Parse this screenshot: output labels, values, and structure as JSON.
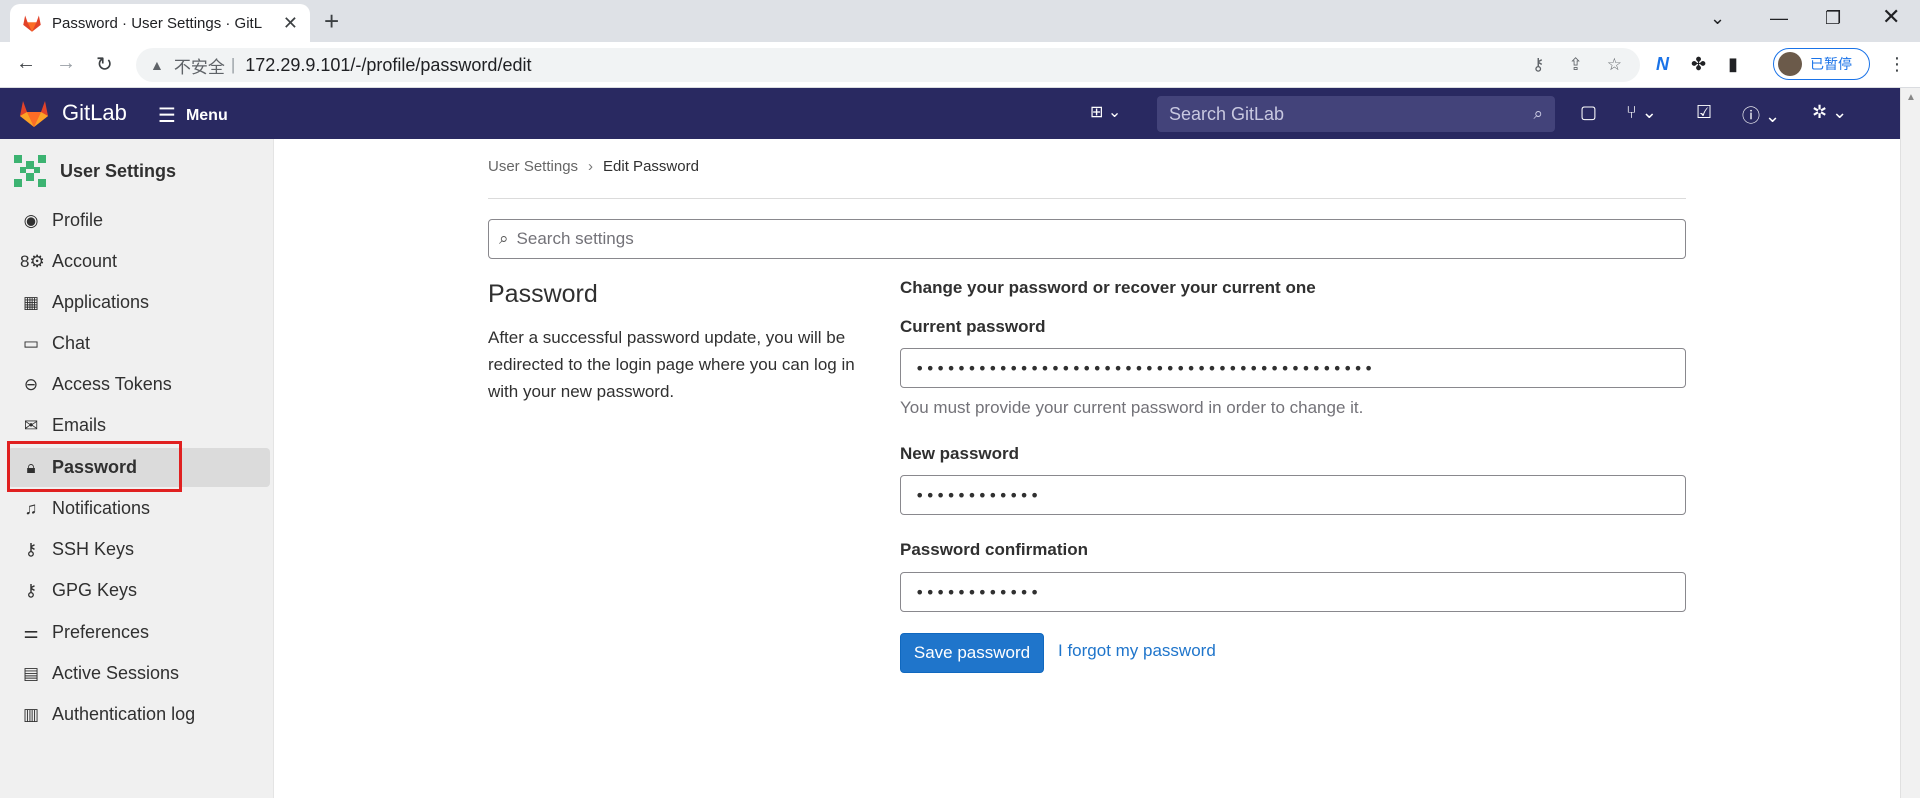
{
  "browser": {
    "tab_title": "Password · User Settings · GitL",
    "insecure_label": "不安全",
    "separator": "|",
    "url": "172.29.9.101/-/profile/password/edit",
    "profile_label": "已暂停"
  },
  "topnav": {
    "brand": "GitLab",
    "menu_label": "Menu",
    "search_placeholder": "Search GitLab"
  },
  "sidebar": {
    "title": "User Settings",
    "items": [
      {
        "label": "Profile",
        "icon": "profile-icon"
      },
      {
        "label": "Account",
        "icon": "account-icon"
      },
      {
        "label": "Applications",
        "icon": "applications-icon"
      },
      {
        "label": "Chat",
        "icon": "chat-icon"
      },
      {
        "label": "Access Tokens",
        "icon": "token-icon"
      },
      {
        "label": "Emails",
        "icon": "mail-icon"
      },
      {
        "label": "Password",
        "icon": "lock-icon",
        "active": true
      },
      {
        "label": "Notifications",
        "icon": "bell-icon"
      },
      {
        "label": "SSH Keys",
        "icon": "key-icon"
      },
      {
        "label": "GPG Keys",
        "icon": "key-icon"
      },
      {
        "label": "Preferences",
        "icon": "preferences-icon"
      },
      {
        "label": "Active Sessions",
        "icon": "monitor-icon"
      },
      {
        "label": "Authentication log",
        "icon": "log-icon"
      }
    ]
  },
  "breadcrumb": {
    "parent": "User Settings",
    "current": "Edit Password"
  },
  "settings_search": {
    "placeholder": "Search settings"
  },
  "section": {
    "title": "Password",
    "description": "After a successful password update, you will be redirected to the login page where you can log in with your new password."
  },
  "form": {
    "lead": "Change your password or recover your current one",
    "current_label": "Current password",
    "current_value": "••••••••••••••••••••••••••••••••••••••••••••",
    "current_help": "You must provide your current password in order to change it.",
    "new_label": "New password",
    "new_value": "••••••••••••",
    "confirm_label": "Password confirmation",
    "confirm_value": "••••••••••••",
    "save_label": "Save password",
    "forgot_label": "I forgot my password"
  }
}
